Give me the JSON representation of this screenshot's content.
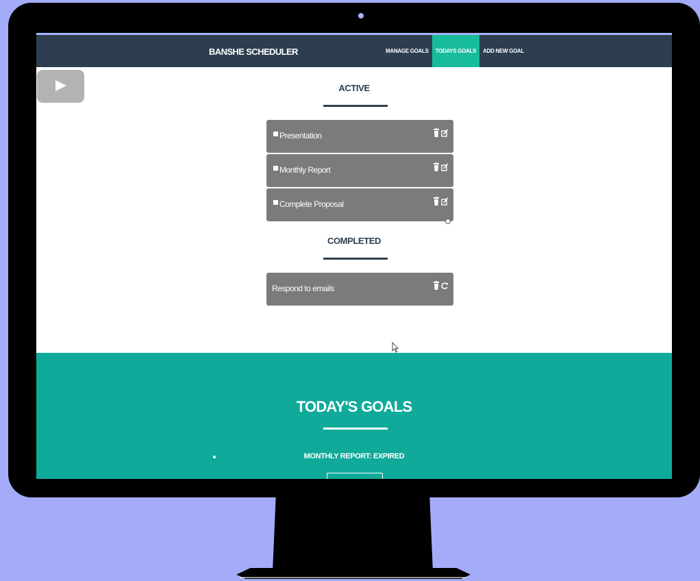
{
  "navbar": {
    "brand": "BANSHE SCHEDULER",
    "links": [
      "MANAGE GOALS",
      "TODAYS GOALS",
      "ADD NEW GOAL"
    ],
    "active_link": "TODAYS GOALS",
    "bg_color": "#2c3e50",
    "accent_color": "#18bc9c"
  },
  "active_section": {
    "title": "ACTIVE",
    "goals": [
      {
        "label": "Presentation",
        "icons": [
          "trash-icon",
          "edit-icon"
        ]
      },
      {
        "label": "Monthly Report",
        "icons": [
          "trash-icon",
          "edit-icon"
        ]
      },
      {
        "label": "Complete Proposal",
        "icons": [
          "trash-icon",
          "edit-icon"
        ]
      }
    ]
  },
  "completed_section": {
    "title": "COMPLETED",
    "goals": [
      {
        "label": "Respond to emails",
        "icons": [
          "trash-icon",
          "restore-icon"
        ]
      }
    ]
  },
  "footer": {
    "title": "TODAY'S GOALS",
    "notice": "MONTHLY REPORT: EXPIRED",
    "bg_color": "#10aa9a"
  },
  "overlay": {
    "icon": "play-icon"
  }
}
